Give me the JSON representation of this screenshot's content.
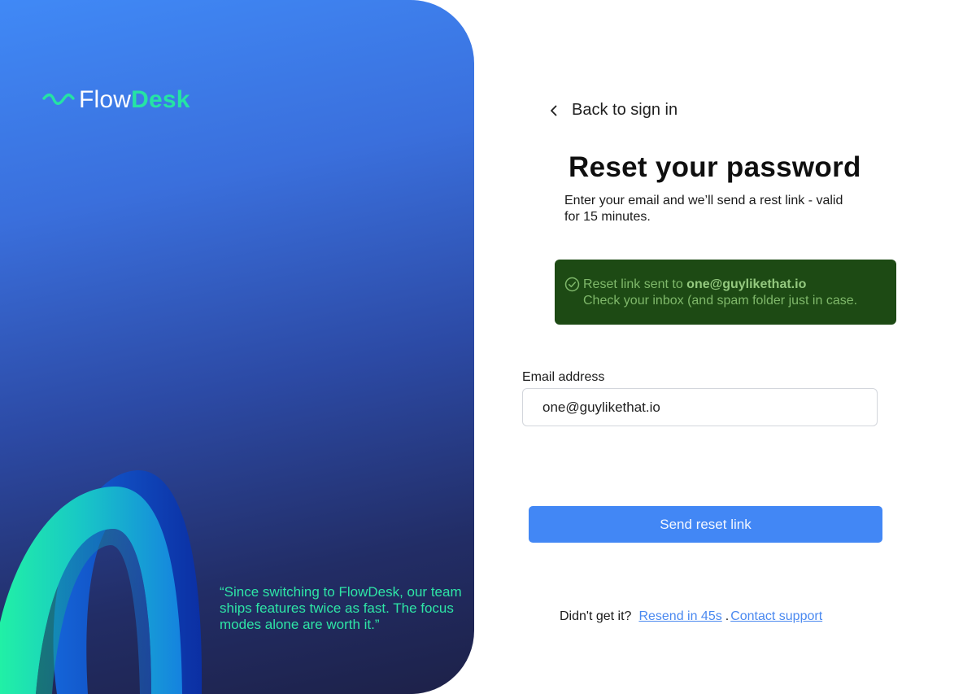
{
  "brand": {
    "name_part1": "Flow",
    "name_part2": "Desk",
    "icon": "wave-icon",
    "accent_color": "#25e3a4"
  },
  "hero": {
    "quote": "“Since switching to FlowDesk, our team ships features twice as fast. The focus modes alone are worth it.”"
  },
  "nav": {
    "back_label": "Back to sign in",
    "back_icon": "chevron-left-icon"
  },
  "form": {
    "title": "Reset your password",
    "subtitle": "Enter your email and we’ll send a rest link - valid for 15 minutes.",
    "email_label": "Email address",
    "email_value": "one@guylikethat.io",
    "submit_label": "Send reset link",
    "submit_color": "#4287f5"
  },
  "alert": {
    "icon": "check-circle-icon",
    "prefix": "Reset link sent to ",
    "email": "one@guylikethat.io",
    "detail": "Check your inbox (and spam folder just in case.",
    "background": "#1d4a14"
  },
  "footer": {
    "prompt": "Didn't get it?",
    "resend_label": "Resend in 45s",
    "separator": ".",
    "support_label": "Contact support"
  }
}
